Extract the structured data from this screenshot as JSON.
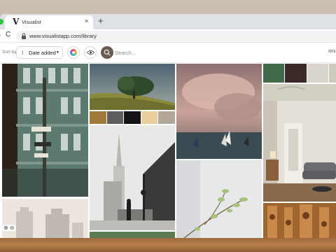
{
  "browser": {
    "tab_title": "Visualist",
    "tab_logo": "V",
    "close_glyph": "×",
    "newtab_glyph": "+",
    "url": "www.visualistapp.com/library",
    "nav_forward": "›",
    "nav_reload": "C"
  },
  "header": {
    "sort_by_label": "Sort by",
    "sort_arrow": "↕",
    "sort_value": "Date added",
    "sort_caret": "▼",
    "search_placeholder": "Search...",
    "right_text": "Ibhi",
    "icons": {
      "color": "color-wheel-icon",
      "eye": "eye-icon",
      "search": "search-icon"
    }
  },
  "library": {
    "zoom_controls": "⊕ ⊖",
    "palette_tree": [
      "#a07a3a",
      "#5d5d5d",
      "#141414",
      "#e8cf9b",
      "#b2a89a"
    ],
    "palette_interior": [
      "#3f6b4b",
      "#3b2a28",
      "#d9d5cd",
      "#cfcac0"
    ]
  }
}
